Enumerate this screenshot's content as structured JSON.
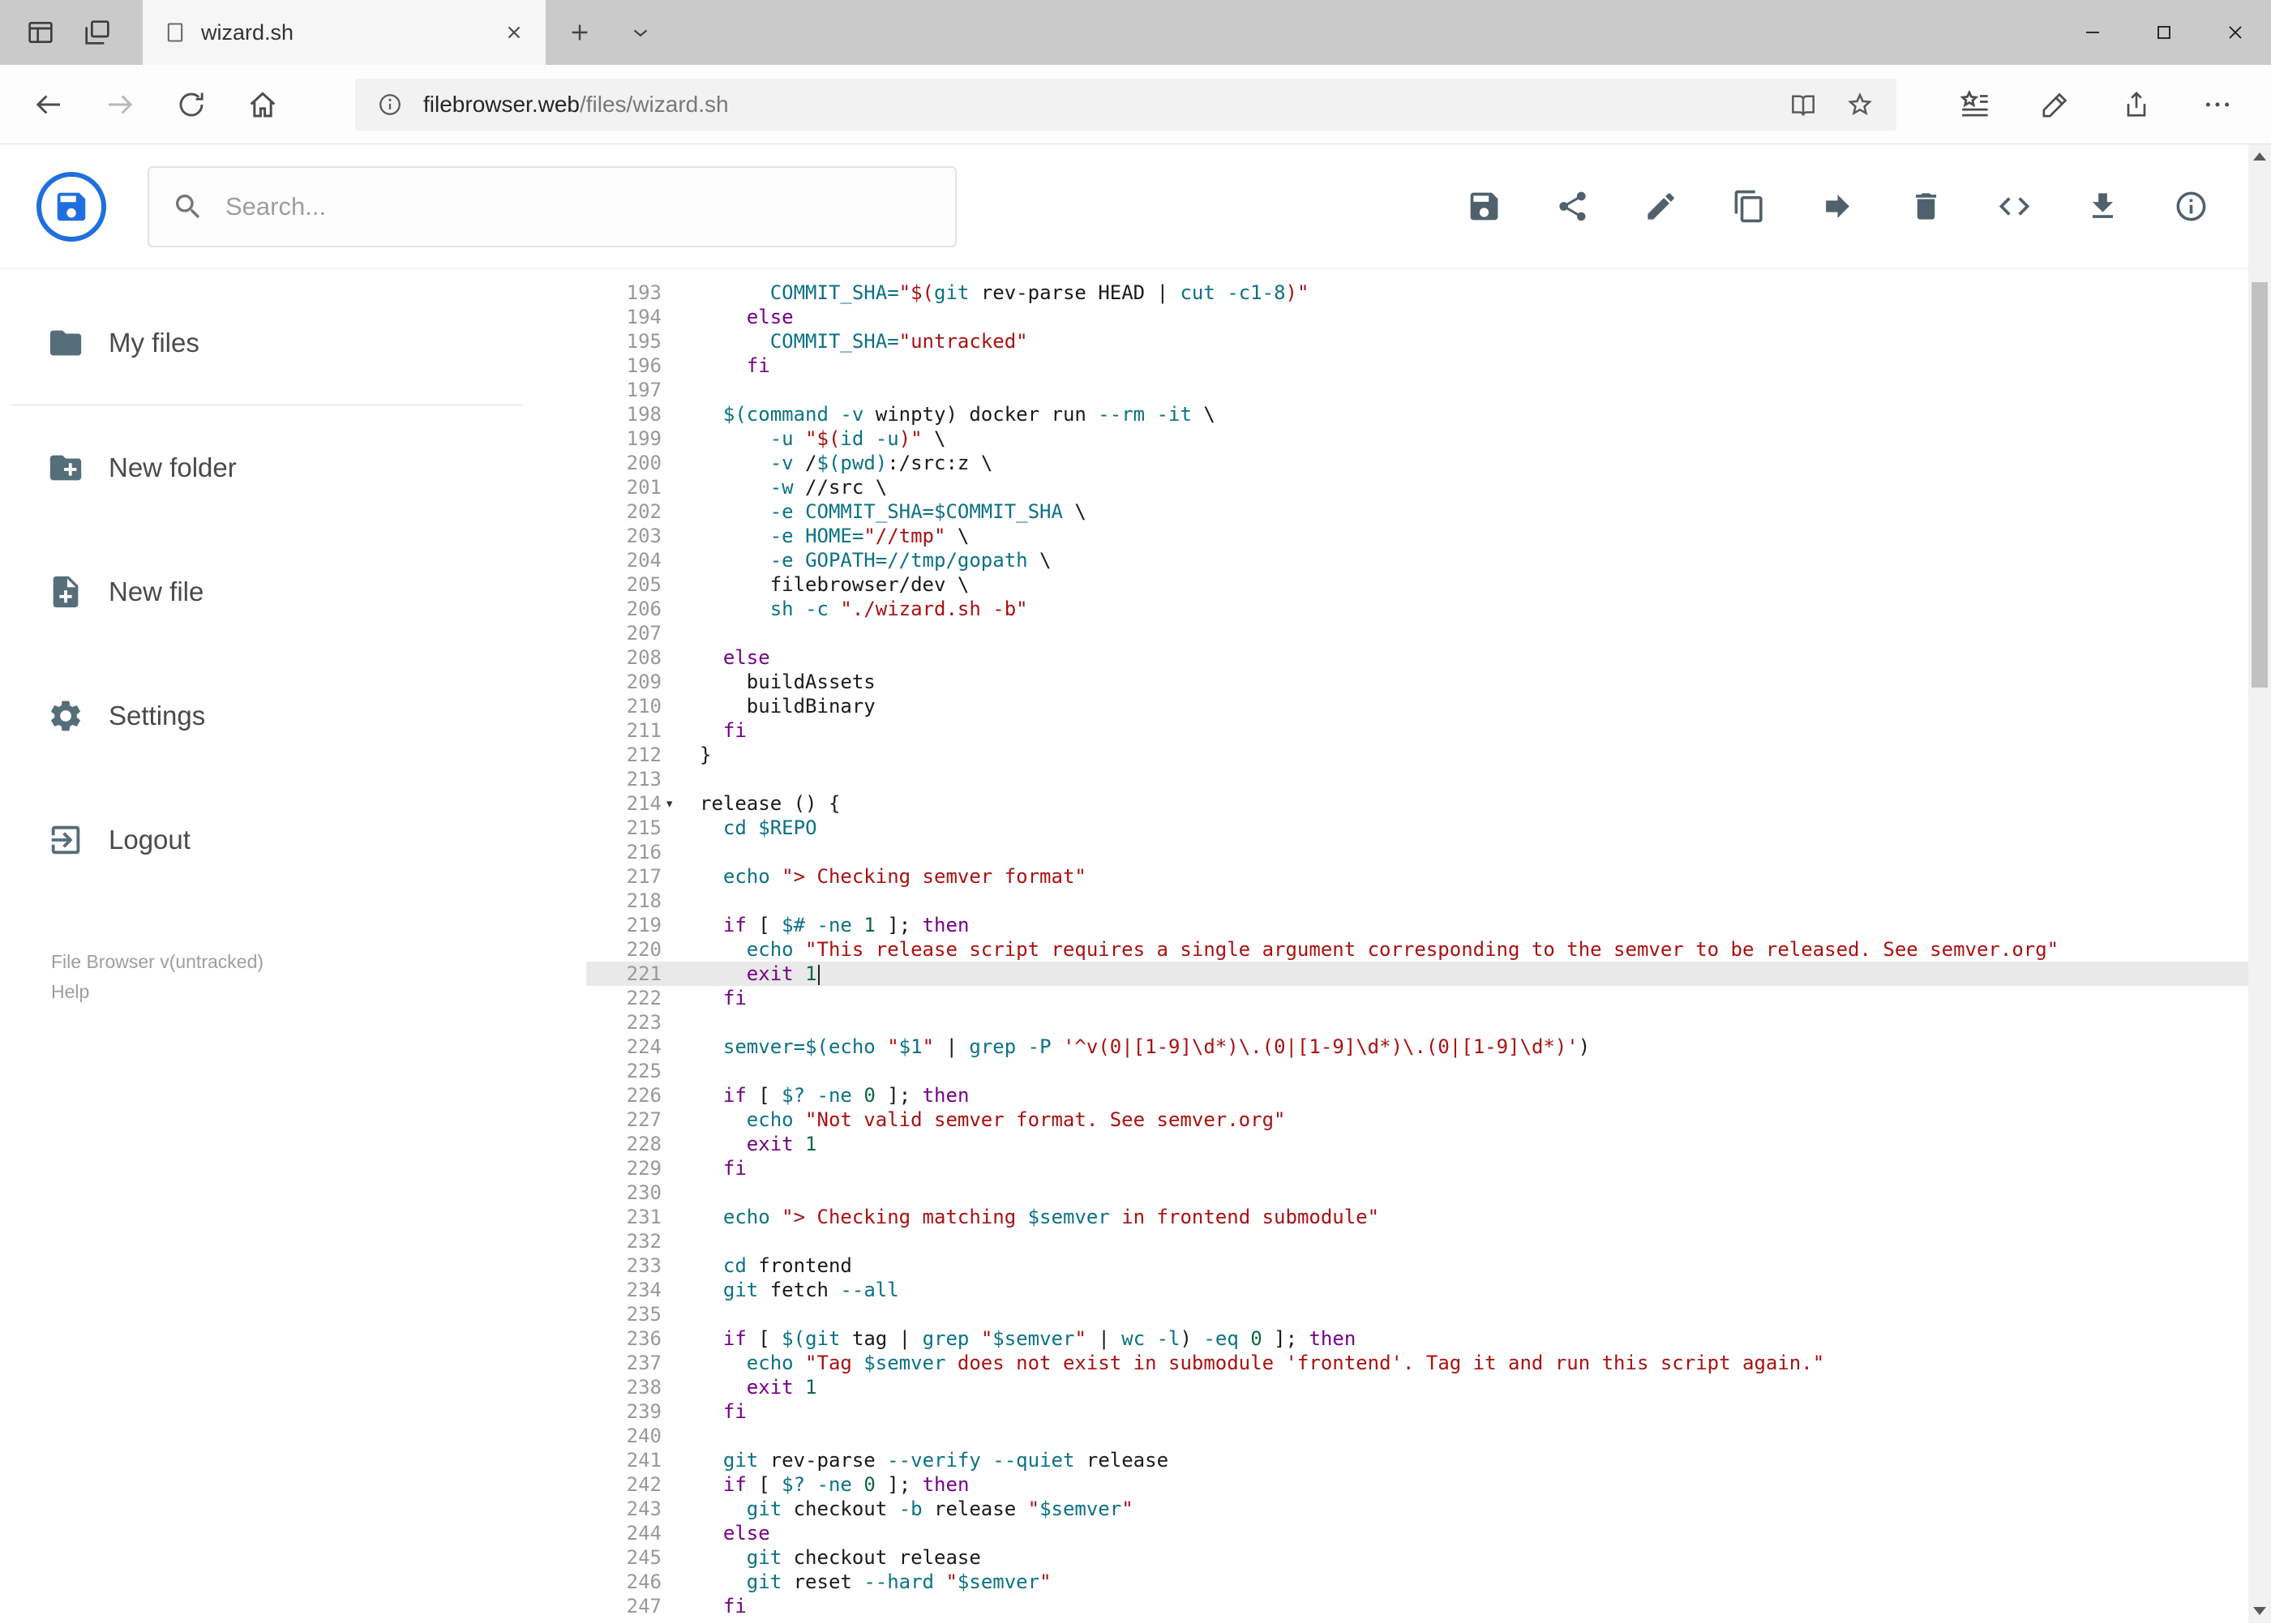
{
  "browser": {
    "tab_title": "wizard.sh",
    "url_host": "filebrowser.web",
    "url_path": "/files/wizard.sh"
  },
  "header": {
    "search_placeholder": "Search...",
    "action_icons": [
      "save",
      "share",
      "edit",
      "copy",
      "move",
      "delete",
      "code",
      "download",
      "info"
    ]
  },
  "sidebar": {
    "items": [
      {
        "label": "My files",
        "icon": "folder"
      },
      {
        "label": "New folder",
        "icon": "folder-plus"
      },
      {
        "label": "New file",
        "icon": "file-plus"
      },
      {
        "label": "Settings",
        "icon": "gear"
      },
      {
        "label": "Logout",
        "icon": "logout"
      }
    ],
    "footer_version": "File Browser v(untracked)",
    "footer_help": "Help"
  },
  "colors": {
    "logo_blue": "#1f6fe0",
    "icon_slate": "#546e7a",
    "keyword": "#770088",
    "builtin_variable": "#0b7285",
    "string": "#aa1111",
    "number": "#116644",
    "active_line_bg": "#e9e9e9",
    "tabbar_gray": "#cacaca"
  },
  "editor": {
    "active_line": 221,
    "lines": [
      {
        "n": 193,
        "t": [
          [
            "p",
            "      "
          ],
          [
            "t",
            "COMMIT_SHA="
          ],
          [
            "s",
            "\"$("
          ],
          [
            "t",
            "git"
          ],
          [
            "p",
            " rev-parse HEAD | "
          ],
          [
            "t",
            "cut"
          ],
          [
            "p",
            " "
          ],
          [
            "t",
            "-c1-8"
          ],
          [
            "s",
            ")\""
          ]
        ]
      },
      {
        "n": 194,
        "t": [
          [
            "p",
            "    "
          ],
          [
            "k",
            "else"
          ]
        ]
      },
      {
        "n": 195,
        "t": [
          [
            "p",
            "      "
          ],
          [
            "t",
            "COMMIT_SHA="
          ],
          [
            "s",
            "\"untracked\""
          ]
        ]
      },
      {
        "n": 196,
        "t": [
          [
            "p",
            "    "
          ],
          [
            "k",
            "fi"
          ]
        ]
      },
      {
        "n": 197,
        "t": []
      },
      {
        "n": 198,
        "t": [
          [
            "p",
            "  "
          ],
          [
            "t",
            "$(command"
          ],
          [
            "p",
            " "
          ],
          [
            "t",
            "-v"
          ],
          [
            "p",
            " winpty) docker run "
          ],
          [
            "t",
            "--rm"
          ],
          [
            "p",
            " "
          ],
          [
            "t",
            "-it"
          ],
          [
            "p",
            " \\"
          ]
        ]
      },
      {
        "n": 199,
        "t": [
          [
            "p",
            "      "
          ],
          [
            "t",
            "-u"
          ],
          [
            "p",
            " "
          ],
          [
            "s",
            "\"$("
          ],
          [
            "t",
            "id"
          ],
          [
            "p",
            " "
          ],
          [
            "t",
            "-u"
          ],
          [
            "s",
            ")\""
          ],
          [
            "p",
            " \\"
          ]
        ]
      },
      {
        "n": 200,
        "t": [
          [
            "p",
            "      "
          ],
          [
            "t",
            "-v"
          ],
          [
            "p",
            " /"
          ],
          [
            "t",
            "$(pwd)"
          ],
          [
            "p",
            ":/src:z \\"
          ]
        ]
      },
      {
        "n": 201,
        "t": [
          [
            "p",
            "      "
          ],
          [
            "t",
            "-w"
          ],
          [
            "p",
            " //src \\"
          ]
        ]
      },
      {
        "n": 202,
        "t": [
          [
            "p",
            "      "
          ],
          [
            "t",
            "-e"
          ],
          [
            "p",
            " "
          ],
          [
            "t",
            "COMMIT_SHA=$COMMIT_SHA"
          ],
          [
            "p",
            " \\"
          ]
        ]
      },
      {
        "n": 203,
        "t": [
          [
            "p",
            "      "
          ],
          [
            "t",
            "-e"
          ],
          [
            "p",
            " "
          ],
          [
            "t",
            "HOME="
          ],
          [
            "s",
            "\"//tmp\""
          ],
          [
            "p",
            " \\"
          ]
        ]
      },
      {
        "n": 204,
        "t": [
          [
            "p",
            "      "
          ],
          [
            "t",
            "-e"
          ],
          [
            "p",
            " "
          ],
          [
            "t",
            "GOPATH=//tmp/gopath"
          ],
          [
            "p",
            " \\"
          ]
        ]
      },
      {
        "n": 205,
        "t": [
          [
            "p",
            "      filebrowser/dev \\"
          ]
        ]
      },
      {
        "n": 206,
        "t": [
          [
            "p",
            "      "
          ],
          [
            "t",
            "sh"
          ],
          [
            "p",
            " "
          ],
          [
            "t",
            "-c"
          ],
          [
            "p",
            " "
          ],
          [
            "s",
            "\"./wizard.sh -b\""
          ]
        ]
      },
      {
        "n": 207,
        "t": []
      },
      {
        "n": 208,
        "t": [
          [
            "p",
            "  "
          ],
          [
            "k",
            "else"
          ]
        ]
      },
      {
        "n": 209,
        "t": [
          [
            "p",
            "    buildAssets"
          ]
        ]
      },
      {
        "n": 210,
        "t": [
          [
            "p",
            "    buildBinary"
          ]
        ]
      },
      {
        "n": 211,
        "t": [
          [
            "p",
            "  "
          ],
          [
            "k",
            "fi"
          ]
        ]
      },
      {
        "n": 212,
        "t": [
          [
            "p",
            "}"
          ]
        ]
      },
      {
        "n": 213,
        "t": []
      },
      {
        "n": 214,
        "t": [
          [
            "p",
            "release () {"
          ]
        ],
        "fold": true
      },
      {
        "n": 215,
        "t": [
          [
            "p",
            "  "
          ],
          [
            "t",
            "cd"
          ],
          [
            "p",
            " "
          ],
          [
            "t",
            "$REPO"
          ]
        ]
      },
      {
        "n": 216,
        "t": []
      },
      {
        "n": 217,
        "t": [
          [
            "p",
            "  "
          ],
          [
            "t",
            "echo"
          ],
          [
            "p",
            " "
          ],
          [
            "s",
            "\"> Checking semver format\""
          ]
        ]
      },
      {
        "n": 218,
        "t": []
      },
      {
        "n": 219,
        "t": [
          [
            "p",
            "  "
          ],
          [
            "k",
            "if"
          ],
          [
            "p",
            " [ "
          ],
          [
            "t",
            "$#"
          ],
          [
            "p",
            " "
          ],
          [
            "t",
            "-ne"
          ],
          [
            "p",
            " "
          ],
          [
            "n",
            "1"
          ],
          [
            "p",
            " ]; "
          ],
          [
            "k",
            "then"
          ]
        ]
      },
      {
        "n": 220,
        "t": [
          [
            "p",
            "    "
          ],
          [
            "t",
            "echo"
          ],
          [
            "p",
            " "
          ],
          [
            "s",
            "\"This release script requires a single argument corresponding to the semver to be released. See semver.org\""
          ]
        ]
      },
      {
        "n": 221,
        "t": [
          [
            "p",
            "    "
          ],
          [
            "k",
            "exit"
          ],
          [
            "p",
            " "
          ],
          [
            "n",
            "1"
          ]
        ],
        "cursor": true
      },
      {
        "n": 222,
        "t": [
          [
            "p",
            "  "
          ],
          [
            "k",
            "fi"
          ]
        ]
      },
      {
        "n": 223,
        "t": []
      },
      {
        "n": 224,
        "t": [
          [
            "p",
            "  "
          ],
          [
            "t",
            "semver=$("
          ],
          [
            "t",
            "echo"
          ],
          [
            "p",
            " "
          ],
          [
            "s",
            "\""
          ],
          [
            "t",
            "$1"
          ],
          [
            "s",
            "\""
          ],
          [
            "p",
            " | "
          ],
          [
            "t",
            "grep"
          ],
          [
            "p",
            " "
          ],
          [
            "t",
            "-P"
          ],
          [
            "p",
            " "
          ],
          [
            "s",
            "'^v(0|[1-9]\\d*)\\.(0|[1-9]\\d*)\\.(0|[1-9]\\d*)'"
          ],
          [
            "p",
            ")"
          ]
        ]
      },
      {
        "n": 225,
        "t": []
      },
      {
        "n": 226,
        "t": [
          [
            "p",
            "  "
          ],
          [
            "k",
            "if"
          ],
          [
            "p",
            " [ "
          ],
          [
            "t",
            "$?"
          ],
          [
            "p",
            " "
          ],
          [
            "t",
            "-ne"
          ],
          [
            "p",
            " "
          ],
          [
            "n",
            "0"
          ],
          [
            "p",
            " ]; "
          ],
          [
            "k",
            "then"
          ]
        ]
      },
      {
        "n": 227,
        "t": [
          [
            "p",
            "    "
          ],
          [
            "t",
            "echo"
          ],
          [
            "p",
            " "
          ],
          [
            "s",
            "\"Not valid semver format. See semver.org\""
          ]
        ]
      },
      {
        "n": 228,
        "t": [
          [
            "p",
            "    "
          ],
          [
            "k",
            "exit"
          ],
          [
            "p",
            " "
          ],
          [
            "n",
            "1"
          ]
        ]
      },
      {
        "n": 229,
        "t": [
          [
            "p",
            "  "
          ],
          [
            "k",
            "fi"
          ]
        ]
      },
      {
        "n": 230,
        "t": []
      },
      {
        "n": 231,
        "t": [
          [
            "p",
            "  "
          ],
          [
            "t",
            "echo"
          ],
          [
            "p",
            " "
          ],
          [
            "s",
            "\"> Checking matching "
          ],
          [
            "t",
            "$semver"
          ],
          [
            "s",
            " in frontend submodule\""
          ]
        ]
      },
      {
        "n": 232,
        "t": []
      },
      {
        "n": 233,
        "t": [
          [
            "p",
            "  "
          ],
          [
            "t",
            "cd"
          ],
          [
            "p",
            " frontend"
          ]
        ]
      },
      {
        "n": 234,
        "t": [
          [
            "p",
            "  "
          ],
          [
            "t",
            "git"
          ],
          [
            "p",
            " fetch "
          ],
          [
            "t",
            "--all"
          ]
        ]
      },
      {
        "n": 235,
        "t": []
      },
      {
        "n": 236,
        "t": [
          [
            "p",
            "  "
          ],
          [
            "k",
            "if"
          ],
          [
            "p",
            " [ "
          ],
          [
            "t",
            "$(git"
          ],
          [
            "p",
            " tag | "
          ],
          [
            "t",
            "grep"
          ],
          [
            "p",
            " "
          ],
          [
            "s",
            "\""
          ],
          [
            "t",
            "$semver"
          ],
          [
            "s",
            "\""
          ],
          [
            "p",
            " | "
          ],
          [
            "t",
            "wc"
          ],
          [
            "p",
            " "
          ],
          [
            "t",
            "-l"
          ],
          [
            "p",
            ") "
          ],
          [
            "t",
            "-eq"
          ],
          [
            "p",
            " "
          ],
          [
            "n",
            "0"
          ],
          [
            "p",
            " ]; "
          ],
          [
            "k",
            "then"
          ]
        ]
      },
      {
        "n": 237,
        "t": [
          [
            "p",
            "    "
          ],
          [
            "t",
            "echo"
          ],
          [
            "p",
            " "
          ],
          [
            "s",
            "\"Tag "
          ],
          [
            "t",
            "$semver"
          ],
          [
            "s",
            " does not exist in submodule 'frontend'. Tag it and run this script again.\""
          ]
        ]
      },
      {
        "n": 238,
        "t": [
          [
            "p",
            "    "
          ],
          [
            "k",
            "exit"
          ],
          [
            "p",
            " "
          ],
          [
            "n",
            "1"
          ]
        ]
      },
      {
        "n": 239,
        "t": [
          [
            "p",
            "  "
          ],
          [
            "k",
            "fi"
          ]
        ]
      },
      {
        "n": 240,
        "t": []
      },
      {
        "n": 241,
        "t": [
          [
            "p",
            "  "
          ],
          [
            "t",
            "git"
          ],
          [
            "p",
            " rev-parse "
          ],
          [
            "t",
            "--verify"
          ],
          [
            "p",
            " "
          ],
          [
            "t",
            "--quiet"
          ],
          [
            "p",
            " release"
          ]
        ]
      },
      {
        "n": 242,
        "t": [
          [
            "p",
            "  "
          ],
          [
            "k",
            "if"
          ],
          [
            "p",
            " [ "
          ],
          [
            "t",
            "$?"
          ],
          [
            "p",
            " "
          ],
          [
            "t",
            "-ne"
          ],
          [
            "p",
            " "
          ],
          [
            "n",
            "0"
          ],
          [
            "p",
            " ]; "
          ],
          [
            "k",
            "then"
          ]
        ]
      },
      {
        "n": 243,
        "t": [
          [
            "p",
            "    "
          ],
          [
            "t",
            "git"
          ],
          [
            "p",
            " checkout "
          ],
          [
            "t",
            "-b"
          ],
          [
            "p",
            " release "
          ],
          [
            "s",
            "\""
          ],
          [
            "t",
            "$semver"
          ],
          [
            "s",
            "\""
          ]
        ]
      },
      {
        "n": 244,
        "t": [
          [
            "p",
            "  "
          ],
          [
            "k",
            "else"
          ]
        ]
      },
      {
        "n": 245,
        "t": [
          [
            "p",
            "    "
          ],
          [
            "t",
            "git"
          ],
          [
            "p",
            " checkout release"
          ]
        ]
      },
      {
        "n": 246,
        "t": [
          [
            "p",
            "    "
          ],
          [
            "t",
            "git"
          ],
          [
            "p",
            " reset "
          ],
          [
            "t",
            "--hard"
          ],
          [
            "p",
            " "
          ],
          [
            "s",
            "\""
          ],
          [
            "t",
            "$semver"
          ],
          [
            "s",
            "\""
          ]
        ]
      },
      {
        "n": 247,
        "t": [
          [
            "p",
            "  "
          ],
          [
            "k",
            "fi"
          ]
        ]
      }
    ]
  }
}
